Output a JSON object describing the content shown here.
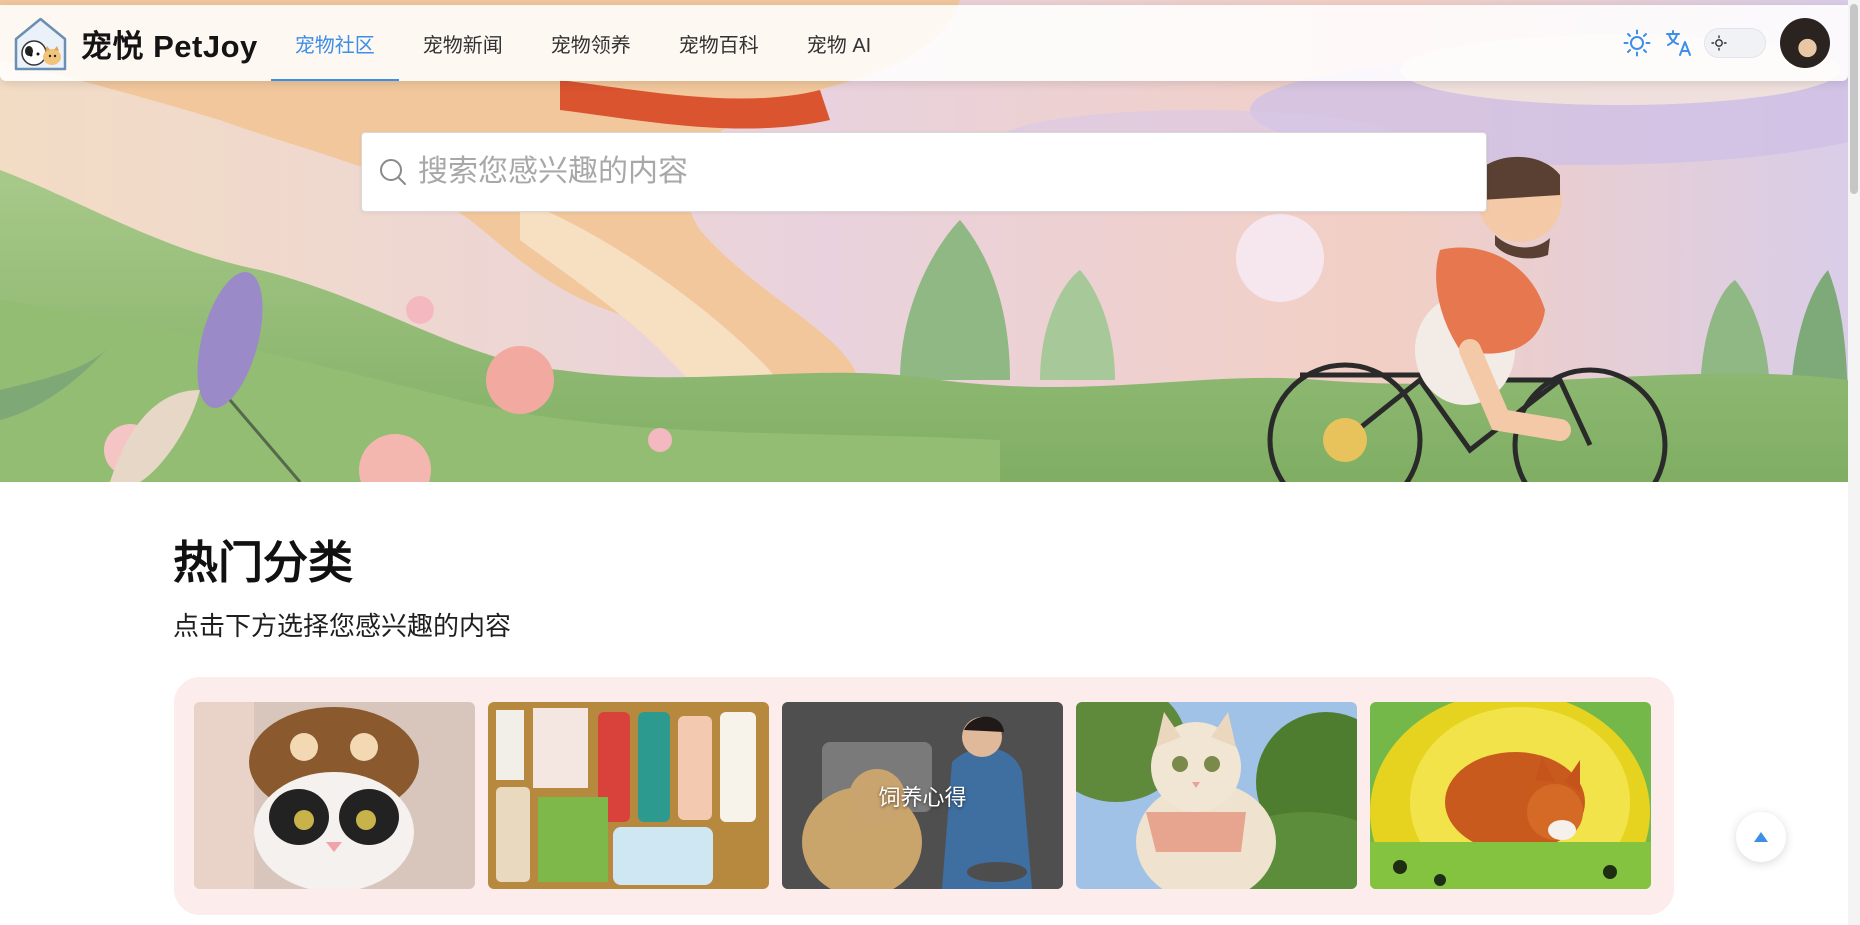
{
  "brand": {
    "name": "宠悦 PetJoy",
    "logo_icon": "pet-house-logo-icon"
  },
  "nav": {
    "items": [
      {
        "label": "宠物社区",
        "active": true
      },
      {
        "label": "宠物新闻",
        "active": false
      },
      {
        "label": "宠物领养",
        "active": false
      },
      {
        "label": "宠物百科",
        "active": false
      },
      {
        "label": "宠物 AI",
        "active": false
      }
    ],
    "accent_color": "#3d8ee6"
  },
  "tools": {
    "theme_icon": "sun-icon",
    "language_icon": "translate-icon",
    "dark_mode_toggle": {
      "icon": "sun-icon",
      "on": false
    },
    "avatar": "user-avatar"
  },
  "search": {
    "placeholder": "搜索您感兴趣的内容",
    "value": "",
    "icon": "search-icon"
  },
  "hot_categories": {
    "title": "热门分类",
    "subtitle": "点击下方选择您感兴趣的内容",
    "panel_color": "#fdecec",
    "cards": [
      {
        "image": "cat-in-bear-hat-photo",
        "label": ""
      },
      {
        "image": "pet-care-products-photo",
        "label": ""
      },
      {
        "image": "woman-feeding-dog-photo",
        "label": "饲养心得"
      },
      {
        "image": "cat-in-harness-photo",
        "label": ""
      },
      {
        "image": "corgi-in-tunnel-photo",
        "label": ""
      }
    ]
  },
  "back_to_top_icon": "arrow-up-icon"
}
